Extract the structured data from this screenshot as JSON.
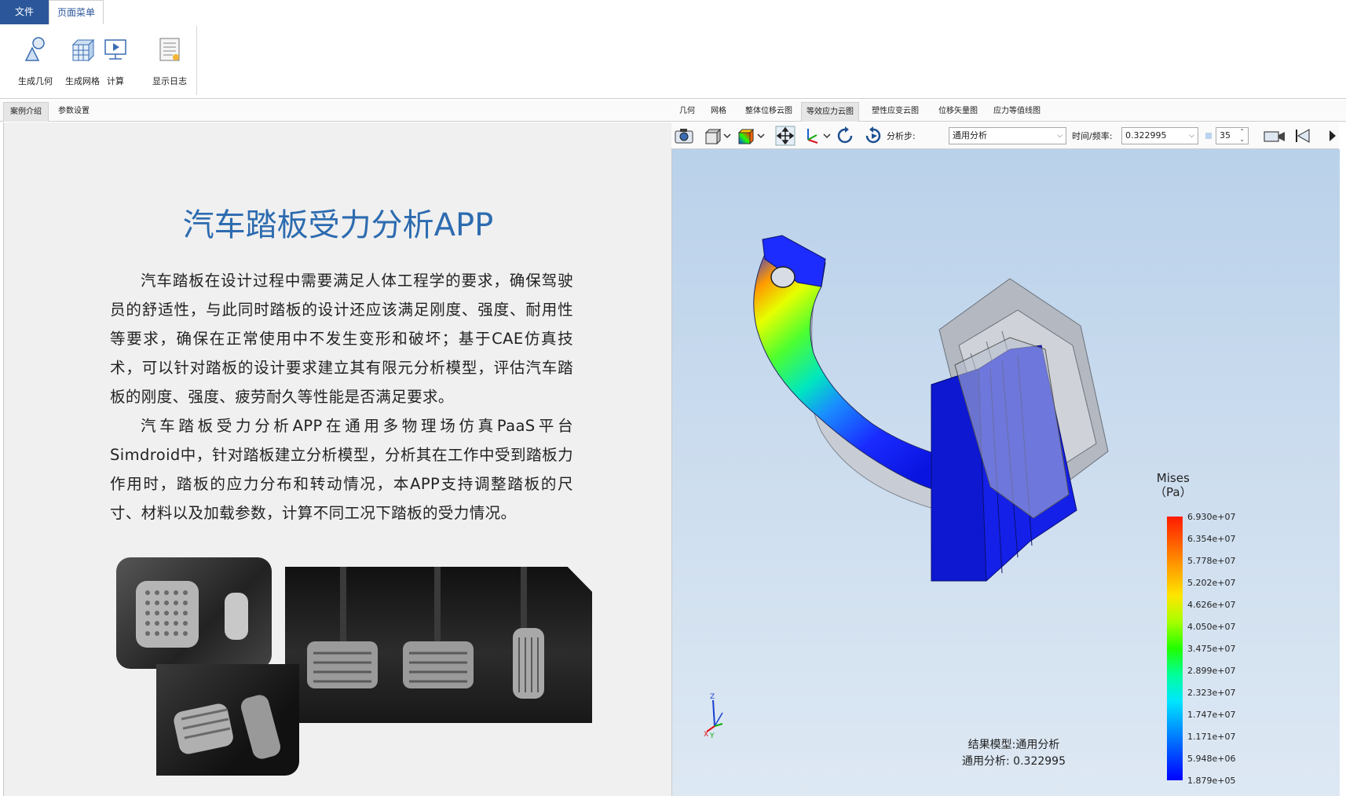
{
  "menu": {
    "file": "文件",
    "page_menu": "页面菜单"
  },
  "ribbon": {
    "buttons": [
      {
        "label": "生成几何",
        "icon": "geometry-icon"
      },
      {
        "label": "生成网格",
        "icon": "mesh-icon"
      },
      {
        "label": "计算",
        "icon": "compute-icon"
      },
      {
        "label": "显示日志",
        "icon": "log-icon"
      }
    ]
  },
  "left": {
    "tabs": [
      "案例介绍",
      "参数设置"
    ],
    "title": "汽车踏板受力分析APP",
    "para1": "汽车踏板在设计过程中需要满足人体工程学的要求，确保驾驶员的舒适性，与此同时踏板的设计还应该满足刚度、强度、耐用性等要求，确保在正常使用中不发生变形和破坏；基于CAE仿真技术，可以针对踏板的设计要求建立其有限元分析模型，评估汽车踏板的刚度、强度、疲劳耐久等性能是否满足要求。",
    "para2": "汽车踏板受力分析APP在通用多物理场仿真PaaS平台Simdroid中，针对踏板建立分析模型，分析其在工作中受到踏板力作用时，踏板的应力分布和转动情况，本APP支持调整踏板的尺寸、材料以及加载参数，计算不同工况下踏板的受力情况。"
  },
  "right": {
    "tabs": [
      "几何",
      "网格",
      "整体位移云图",
      "等效应力云图",
      "塑性应变云图",
      "位移矢量图",
      "应力等值线图"
    ],
    "active_tab": "等效应力云图",
    "toolbar": {
      "step_label": "分析步:",
      "step_value": "通用分析",
      "time_label": "时间/频率:",
      "time_value": "0.322995",
      "count_value": "35"
    },
    "legend": {
      "title_line1": "Mises",
      "title_line2": "（Pa）",
      "values": [
        "6.930e+07",
        "6.354e+07",
        "5.778e+07",
        "5.202e+07",
        "4.626e+07",
        "4.050e+07",
        "3.475e+07",
        "2.899e+07",
        "2.323e+07",
        "1.747e+07",
        "1.171e+07",
        "5.948e+06",
        "1.879e+05"
      ]
    },
    "result": {
      "line1": "结果模型:通用分析",
      "line2": "通用分析: 0.322995"
    },
    "axes": {
      "z": "Z",
      "x": "X",
      "y": "Y"
    }
  },
  "colors": {
    "accent": "#2b579a",
    "title_blue": "#2d6bb0"
  }
}
